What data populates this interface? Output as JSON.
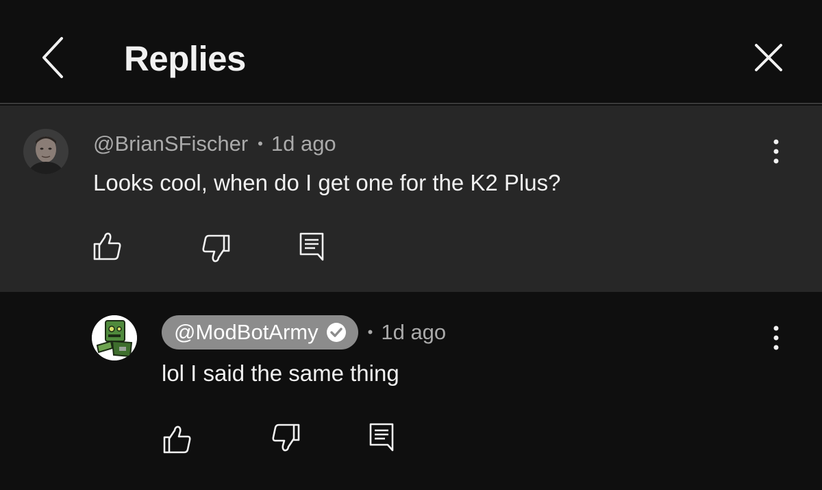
{
  "header": {
    "title": "Replies",
    "back_icon": "chevron-left-icon",
    "close_icon": "close-icon"
  },
  "parent_comment": {
    "username": "@BrianSFischer",
    "timestamp": "1d ago",
    "text": "Looks cool, when do I get one for the K2 Plus?",
    "background": "#272727"
  },
  "reply_comment": {
    "username": "@ModBotArmy",
    "timestamp": "1d ago",
    "text": "lol I said the same thing",
    "badge": "verified-check-icon",
    "pill_color": "#8c8c8c"
  },
  "separator": "•",
  "colors": {
    "background": "#0f0f0f",
    "text": "#f1f1f1",
    "secondary_text": "#aaaaaa"
  }
}
